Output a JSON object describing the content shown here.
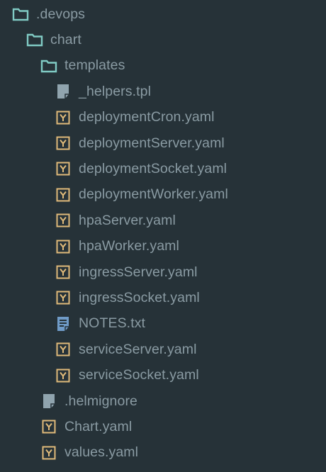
{
  "tree": [
    {
      "label": ".devops",
      "type": "folder",
      "depth": 0
    },
    {
      "label": "chart",
      "type": "folder",
      "depth": 1
    },
    {
      "label": "templates",
      "type": "folder",
      "depth": 2
    },
    {
      "label": "_helpers.tpl",
      "type": "file",
      "depth": 3
    },
    {
      "label": "deploymentCron.yaml",
      "type": "yaml",
      "depth": 3
    },
    {
      "label": "deploymentServer.yaml",
      "type": "yaml",
      "depth": 3
    },
    {
      "label": "deploymentSocket.yaml",
      "type": "yaml",
      "depth": 3
    },
    {
      "label": "deploymentWorker.yaml",
      "type": "yaml",
      "depth": 3
    },
    {
      "label": "hpaServer.yaml",
      "type": "yaml",
      "depth": 3
    },
    {
      "label": "hpaWorker.yaml",
      "type": "yaml",
      "depth": 3
    },
    {
      "label": "ingressServer.yaml",
      "type": "yaml",
      "depth": 3
    },
    {
      "label": "ingressSocket.yaml",
      "type": "yaml",
      "depth": 3
    },
    {
      "label": "NOTES.txt",
      "type": "text",
      "depth": 3
    },
    {
      "label": "serviceServer.yaml",
      "type": "yaml",
      "depth": 3
    },
    {
      "label": "serviceSocket.yaml",
      "type": "yaml",
      "depth": 3
    },
    {
      "label": ".helmignore",
      "type": "file",
      "depth": 2
    },
    {
      "label": "Chart.yaml",
      "type": "yaml",
      "depth": 2
    },
    {
      "label": "values.yaml",
      "type": "yaml",
      "depth": 2
    }
  ],
  "icons": {
    "folder": "folder-icon",
    "file": "file-icon",
    "yaml": "yaml-file-icon",
    "text": "text-file-icon"
  },
  "colors": {
    "background": "#263238",
    "text": "#8a9ba3",
    "folder": "#80cbc4",
    "yaml": "#e0ba7a",
    "file": "#90a4ae",
    "text_file": "#6f9bc7"
  }
}
